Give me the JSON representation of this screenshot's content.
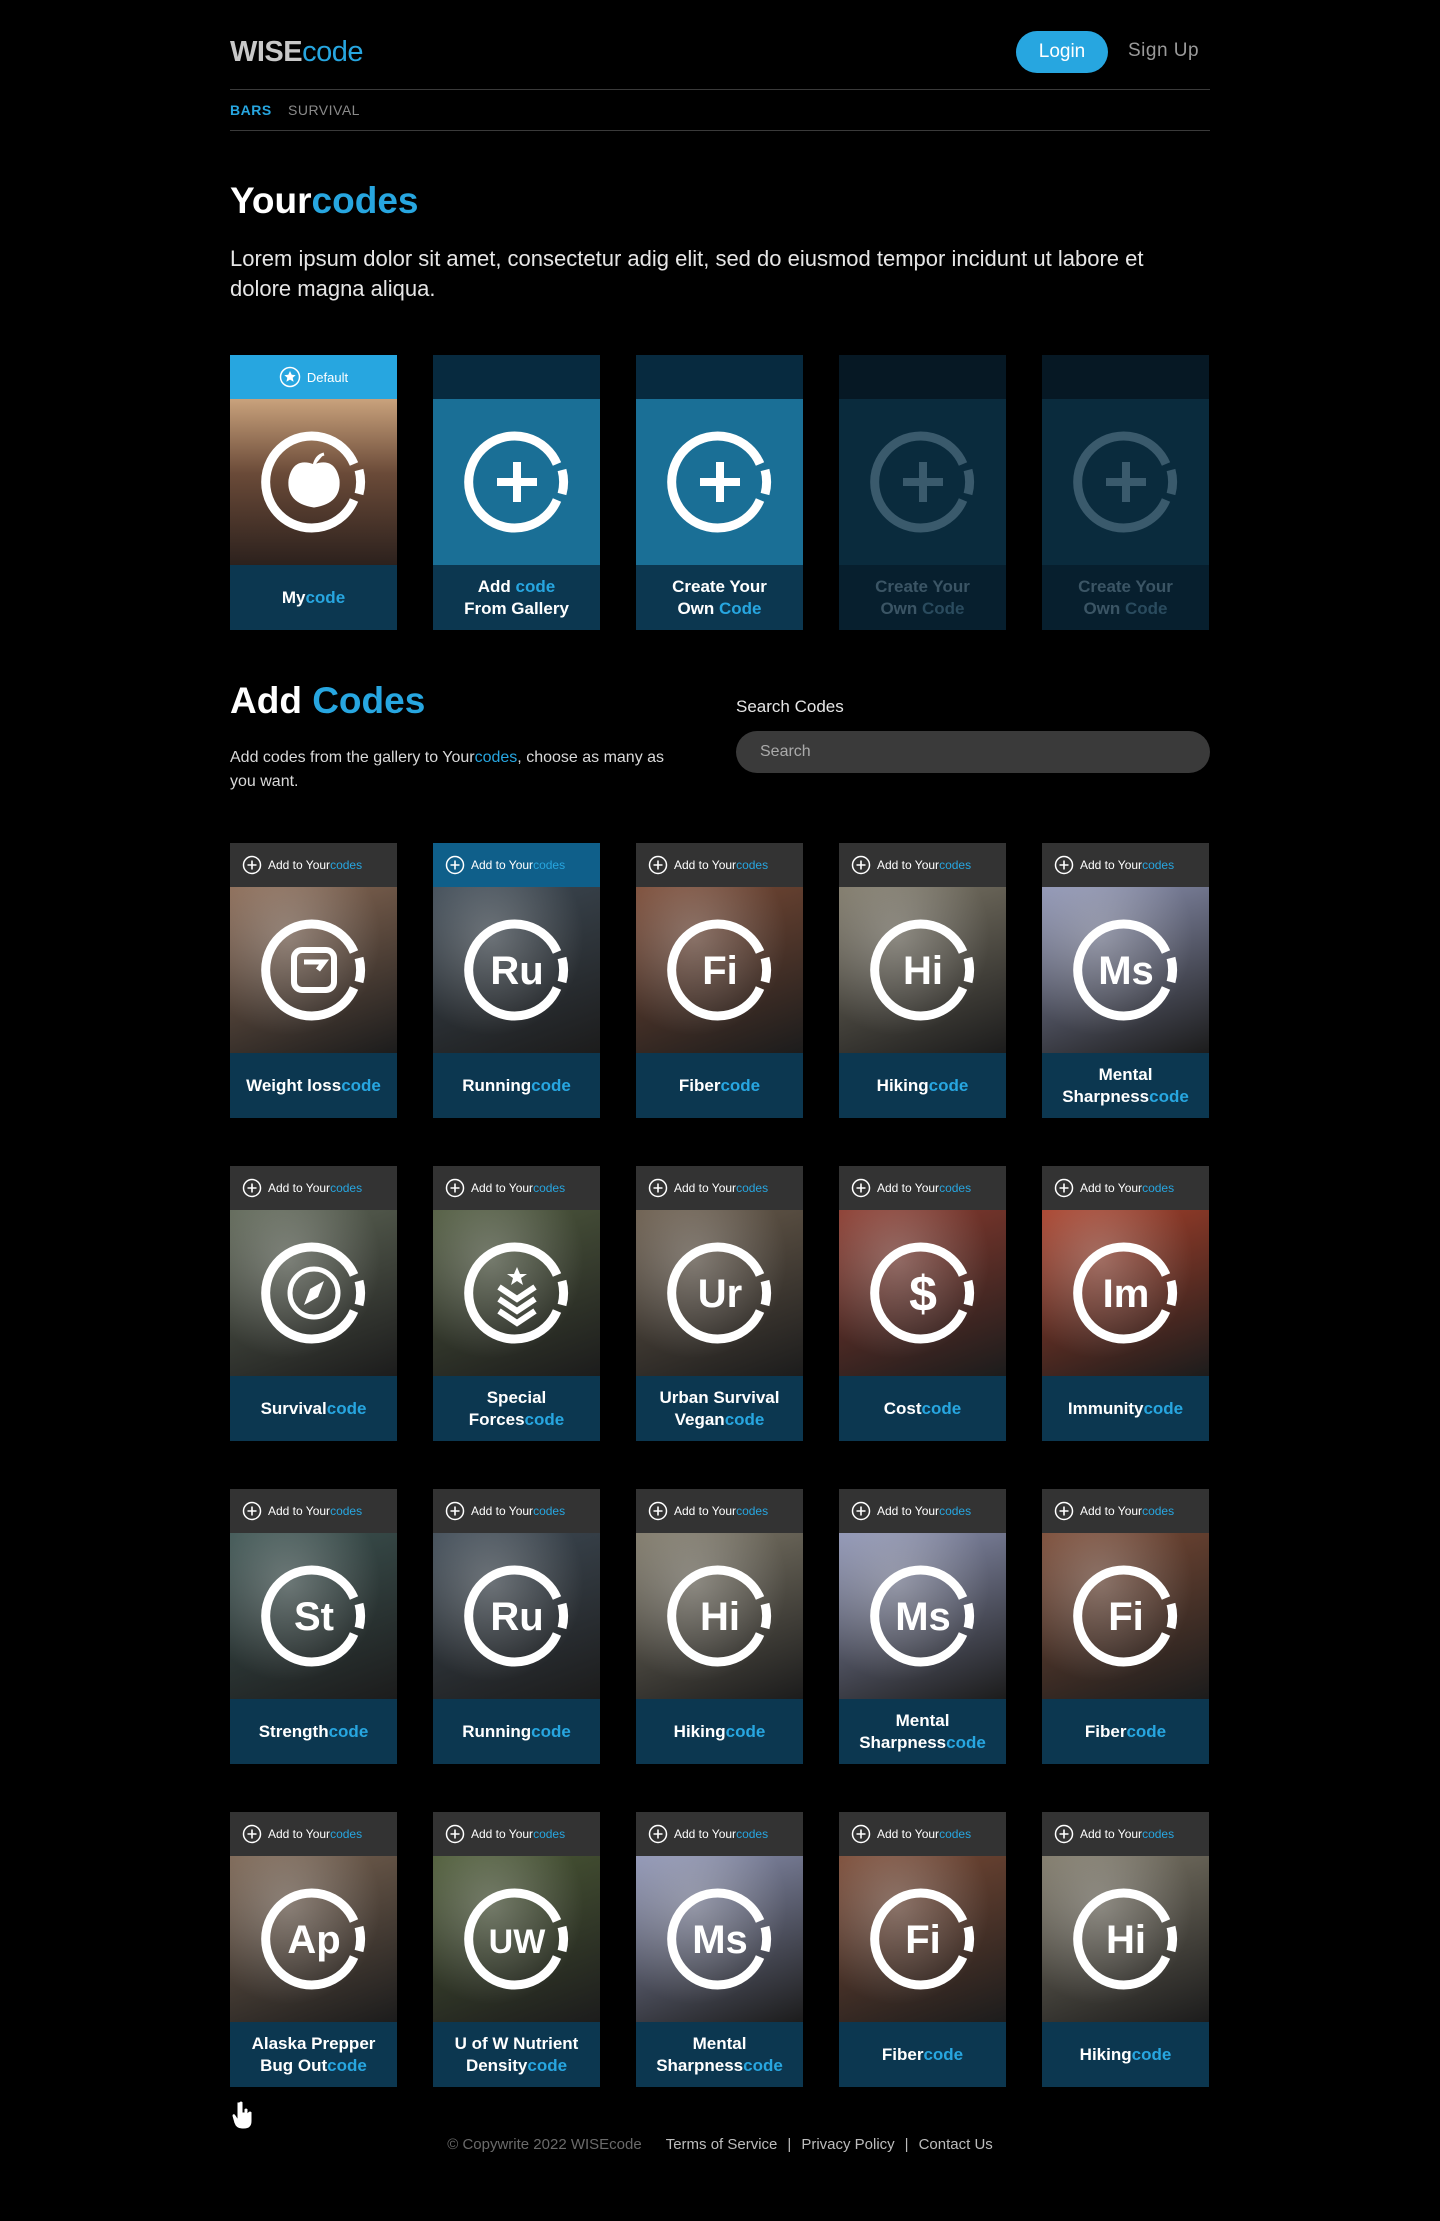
{
  "header": {
    "logo_wise": "WISE",
    "logo_code": "code",
    "login": "Login",
    "signup": "Sign Up"
  },
  "subnav": {
    "bars": "BARS",
    "survival": "SURVIVAL"
  },
  "your_codes": {
    "title_a": "Your",
    "title_b": "codes",
    "intro": "Lorem ipsum dolor sit amet, consectetur adig elit, sed do eiusmod tempor incidunt ut labore et dolore magna aliqua.",
    "cards": [
      {
        "top": "Default",
        "l1": "My",
        "l1b": "code",
        "l2": "",
        "l2b": "",
        "icon": "apple-icon",
        "style": "default"
      },
      {
        "top": "",
        "l1": "Add ",
        "l1b": "code",
        "l2": "From Gallery",
        "l2b": "",
        "icon": "plus-icon",
        "style": "active"
      },
      {
        "top": "",
        "l1": "Create Your",
        "l1b": "",
        "l2": "Own ",
        "l2b": "Code",
        "icon": "plus-icon",
        "style": "active"
      },
      {
        "top": "",
        "l1": "Create Your",
        "l1b": "",
        "l2": "Own ",
        "l2b": "Code",
        "icon": "plus-icon",
        "style": "faded"
      },
      {
        "top": "",
        "l1": "Create Your",
        "l1b": "",
        "l2": "Own ",
        "l2b": "Code",
        "icon": "plus-icon",
        "style": "faded"
      }
    ]
  },
  "add_codes": {
    "title_a": "Add ",
    "title_b": "Codes",
    "desc_a": "Add codes from the gallery to Your",
    "desc_b": "codes",
    "desc_c": ", choose as many as you want.",
    "search_label": "Search Codes",
    "search_placeholder": "Search",
    "add_label_a": "Add to Your",
    "add_label_b": "codes"
  },
  "gallery": [
    {
      "abbr": "",
      "icon": "scale-icon",
      "l1": "Weight loss",
      "l2": "",
      "bg": "#8a6a55",
      "selected": false
    },
    {
      "abbr": "Ru",
      "icon": "",
      "l1": "Running",
      "l2": "",
      "bg": "#3e4a55",
      "selected": true
    },
    {
      "abbr": "Fi",
      "icon": "",
      "l1": "Fiber",
      "l2": "",
      "bg": "#7a4a35",
      "selected": false
    },
    {
      "abbr": "Hi",
      "icon": "",
      "l1": "Hiking",
      "l2": "",
      "bg": "#7e7868",
      "selected": false
    },
    {
      "abbr": "Ms",
      "icon": "",
      "l1": "Mental",
      "l2": "Sharpness",
      "bg": "#8e94b4",
      "selected": false
    },
    {
      "abbr": "",
      "icon": "compass-icon",
      "l1": "Survival",
      "l2": "",
      "bg": "#5e6656",
      "selected": false
    },
    {
      "abbr": "",
      "icon": "rank-icon",
      "l1": "Special",
      "l2": "Forces",
      "bg": "#4f5a3e",
      "selected": false
    },
    {
      "abbr": "Ur",
      "icon": "",
      "l1": "Urban Survival",
      "l2": "Vegan",
      "bg": "#6a5c4c",
      "selected": false
    },
    {
      "abbr": "",
      "icon": "dollar-icon",
      "l1": "Cost",
      "l2": "",
      "bg": "#8a3a2e",
      "selected": false
    },
    {
      "abbr": "Im",
      "icon": "",
      "l1": "Immunity",
      "l2": "",
      "bg": "#a8402a",
      "selected": false
    },
    {
      "abbr": "St",
      "icon": "",
      "l1": "Strength",
      "l2": "",
      "bg": "#3d5452",
      "selected": false
    },
    {
      "abbr": "Ru",
      "icon": "",
      "l1": "Running",
      "l2": "",
      "bg": "#3e4a55",
      "selected": false
    },
    {
      "abbr": "Hi",
      "icon": "",
      "l1": "Hiking",
      "l2": "",
      "bg": "#7e7868",
      "selected": false
    },
    {
      "abbr": "Ms",
      "icon": "",
      "l1": "Mental",
      "l2": "Sharpness",
      "bg": "#8e94b4",
      "selected": false
    },
    {
      "abbr": "Fi",
      "icon": "",
      "l1": "Fiber",
      "l2": "",
      "bg": "#7a4a35",
      "selected": false
    },
    {
      "abbr": "Ap",
      "icon": "",
      "l1": "Alaska Prepper",
      "l2": "Bug Out",
      "bg": "#7a6452",
      "selected": false
    },
    {
      "abbr": "UW",
      "icon": "",
      "l1": "U of W Nutrient",
      "l2": "Density",
      "bg": "#4c5a36",
      "selected": false
    },
    {
      "abbr": "Ms",
      "icon": "",
      "l1": "Mental",
      "l2": "Sharpness",
      "bg": "#8e94b4",
      "selected": false
    },
    {
      "abbr": "Fi",
      "icon": "",
      "l1": "Fiber",
      "l2": "",
      "bg": "#7a4a35",
      "selected": false
    },
    {
      "abbr": "Hi",
      "icon": "",
      "l1": "Hiking",
      "l2": "",
      "bg": "#7e7868",
      "selected": false
    }
  ],
  "code_suffix": "code",
  "footer": {
    "copyright": "© Copywrite 2022 WISEcode",
    "terms": "Terms of Service",
    "privacy": "Privacy Policy",
    "contact": "Contact Us",
    "sep": "|"
  },
  "colors": {
    "accent": "#27a6e0",
    "card": "#0c3750"
  }
}
